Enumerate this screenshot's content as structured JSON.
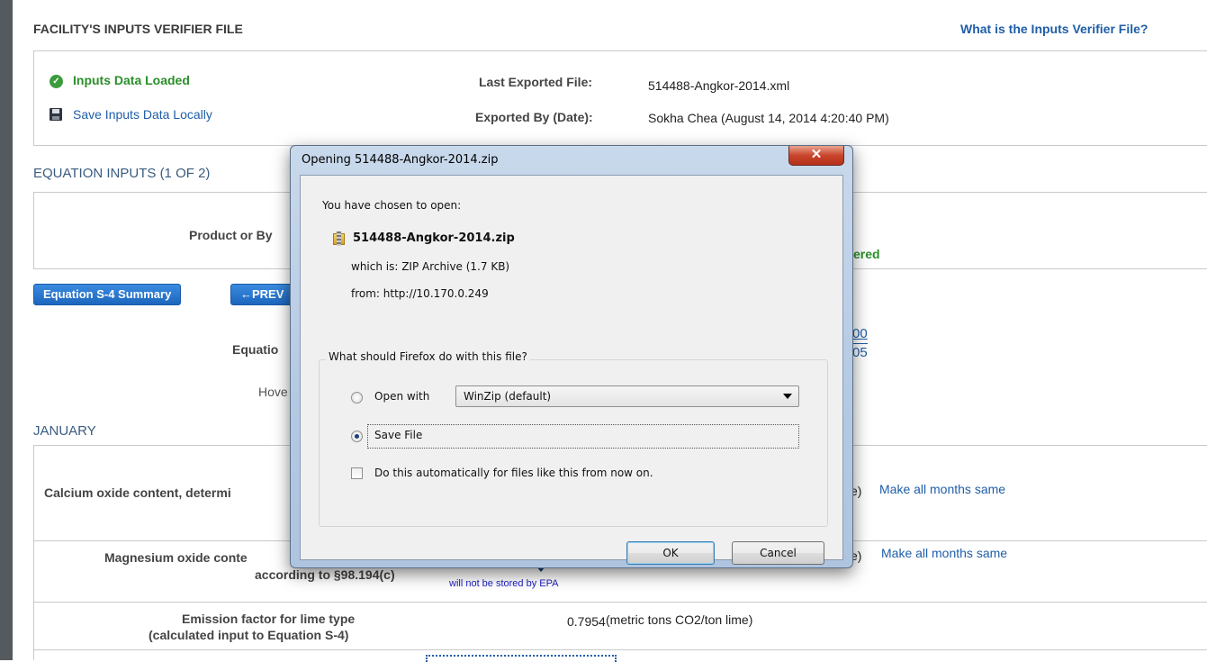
{
  "header": {
    "title": "FACILITY'S INPUTS VERIFIER FILE",
    "help_link": "What is the Inputs Verifier File?"
  },
  "inputs_panel": {
    "status": "Inputs Data Loaded",
    "save_link": "Save Inputs Data Locally",
    "last_exported_label": "Last Exported File:",
    "last_exported_value": "514488-Angkor-2014.xml",
    "exported_by_label": "Exported By (Date):",
    "exported_by_value": "Sokha Chea (August 14, 2014 4:20:40 PM)"
  },
  "equation_inputs": {
    "title": "EQUATION INPUTS (1 OF 2)",
    "product_label": "Product or By",
    "status_fragment": "ered",
    "summary_button": "Equation S-4 Summary",
    "prev_button": "←PREV",
    "equation_label": "Equatio",
    "frac_top": "00",
    "frac_bottom": "05",
    "hover_text": "Hove"
  },
  "month": "JANUARY",
  "rows": [
    {
      "label": "Calcium oxide content, determi",
      "suffix": "e)",
      "link": "Make all months same"
    },
    {
      "label_line1": "Magnesium oxide conte",
      "label_line2": "according to §98.194(c)",
      "suffix": "e)",
      "link": "Make all months same",
      "note": "will not be stored by EPA"
    },
    {
      "label_line1": "Emission factor for lime type",
      "label_line2": "(calculated input to Equation S-4)",
      "value": "0.7954",
      "unit": "(metric tons CO2/ton lime)"
    }
  ],
  "dialog": {
    "title": "Opening 514488-Angkor-2014.zip",
    "intro": "You have chosen to open:",
    "filename": "514488-Angkor-2014.zip",
    "which_is": "which is:  ZIP Archive (1.7 KB)",
    "from": "from:  http://10.170.0.249",
    "question": "What should Firefox do with this file?",
    "open_with_label": "Open with",
    "open_with_value": "WinZip (default)",
    "save_file_label": "Save File",
    "auto_label": "Do this automatically for files like this from now on.",
    "ok_label": "OK",
    "cancel_label": "Cancel",
    "selected_option": "Save File",
    "auto_checked": false
  },
  "colors": {
    "link": "#1f5ea8",
    "status_green": "#2a8f2a",
    "button_blue": "#1d66be"
  }
}
